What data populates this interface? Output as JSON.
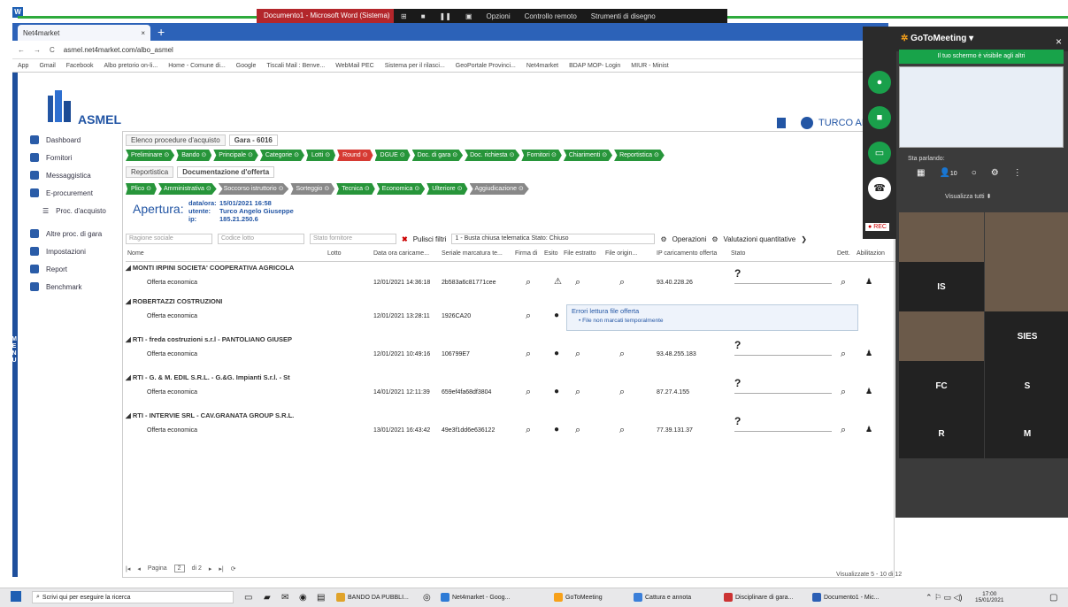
{
  "remote_bar": {
    "title": "Documento1 - Microsoft Word (Sistema)",
    "items": [
      "Opzioni",
      "Controllo remoto",
      "Strumenti di disegno"
    ]
  },
  "browser": {
    "tab_title": "Net4market",
    "url": "asmel.net4market.com/albo_asmel",
    "bookmarks": [
      "App",
      "Gmail",
      "Facebook",
      "Albo pretorio on-li...",
      "Home - Comune di...",
      "Google",
      "Tiscali Mail : Benve...",
      "WebMail PEC",
      "Sistema per il rilasci...",
      "GeoPortale Provinci...",
      "Net4market",
      "BDAP MOP- Login",
      "MIUR - Minist"
    ]
  },
  "app": {
    "logo": "ASMEL",
    "user": "TURCO AN",
    "menu_vertical": "MENU",
    "sidebar": [
      "Dashboard",
      "Fornitori",
      "Messaggistica",
      "E-procurement",
      "Proc. d'acquisto",
      "Altre proc. di gara",
      "Impostazioni",
      "Report",
      "Benchmark"
    ],
    "crumbs1": [
      "Elenco procedure d'acquisto",
      "Gara - 6016"
    ],
    "steps1": [
      {
        "l": "Preliminare",
        "c": "g"
      },
      {
        "l": "Bando",
        "c": "g"
      },
      {
        "l": "Principale",
        "c": "g"
      },
      {
        "l": "Categorie",
        "c": "g"
      },
      {
        "l": "Lotti",
        "c": "g"
      },
      {
        "l": "Round",
        "c": "r"
      },
      {
        "l": "DGUE",
        "c": "g"
      },
      {
        "l": "Doc. di gara",
        "c": "g"
      },
      {
        "l": "Doc. richiesta",
        "c": "g"
      },
      {
        "l": "Fornitori",
        "c": "g"
      },
      {
        "l": "Chiarimenti",
        "c": "g"
      },
      {
        "l": "Reportistica",
        "c": "g"
      }
    ],
    "crumbs2": [
      "Reportistica",
      "Documentazione d'offerta"
    ],
    "steps2": [
      {
        "l": "Plico",
        "c": "g"
      },
      {
        "l": "Amministrativa",
        "c": "g"
      },
      {
        "l": "Soccorso istruttorio",
        "c": "gr"
      },
      {
        "l": "Sorteggio",
        "c": "gr"
      },
      {
        "l": "Tecnica",
        "c": "g"
      },
      {
        "l": "Economica",
        "c": "g"
      },
      {
        "l": "Ulteriore",
        "c": "g"
      },
      {
        "l": "Aggiudicazione",
        "c": "gr"
      }
    ],
    "apertura": "Apertura:",
    "ap_labels": [
      "data/ora:",
      "utente:",
      "ip:"
    ],
    "ap_values": [
      "15/01/2021 16:58",
      "Turco Angelo Giuseppe",
      "185.21.250.6"
    ],
    "filters": {
      "ragione": "Ragione sociale",
      "codice": "Codice lotto",
      "stato": "Stato fornitore",
      "pulisci": "Pulisci filtri",
      "busta": "1 - Busta chiusa telematica  Stato: Chiuso",
      "operazioni": "Operazioni",
      "valutazioni": "Valutazioni quantitative"
    },
    "headers": [
      "Nome",
      "Lotto",
      "Data ora caricame...",
      "Seriale marcatura te...",
      "Firma di",
      "Esito",
      "File estratto",
      "File origin...",
      "IP caricamento offerta",
      "Stato",
      "Dett.",
      "Abilitazion"
    ],
    "groups": [
      {
        "name": "MONTI IRPINI SOCIETA' COOPERATIVA AGRICOLA",
        "sub": "Offerta economica",
        "date": "12/01/2021 14:36:18",
        "serial": "2b583a6c81771cee",
        "ip": "93.40.228.26",
        "esito": "warn"
      },
      {
        "name": "ROBERTAZZI COSTRUZIONI",
        "sub": "Offerta economica",
        "date": "12/01/2021 13:28:11",
        "serial": "1926CA20",
        "ip": "",
        "esito": "ok"
      },
      {
        "name": "RTI - freda costruzioni s.r.l - PANTOLIANO GIUSEP",
        "sub": "Offerta economica",
        "date": "12/01/2021 10:49:16",
        "serial": "106799E7",
        "ip": "93.48.255.183",
        "esito": "ok"
      },
      {
        "name": "RTI - G. & M. EDIL S.R.L. - G.&G. Impianti S.r.l. - St",
        "sub": "Offerta economica",
        "date": "14/01/2021 12:11:39",
        "serial": "659ef4fa68df3804",
        "ip": "87.27.4.155",
        "esito": "ok"
      },
      {
        "name": "RTI - INTERVIE SRL - CAV.GRANATA GROUP S.R.L.",
        "sub": "Offerta economica",
        "date": "13/01/2021 16:43:42",
        "serial": "49e3f1dd6e636122",
        "ip": "77.39.131.37",
        "esito": "ok"
      }
    ],
    "tooltip_title": "Errori lettura file offerta",
    "tooltip_item": "File non marcati temporalmente",
    "pager": {
      "label": "Pagina",
      "page": "2",
      "of": "di 2",
      "summary": "Visualizzate 5 - 10 di 12"
    }
  },
  "gotomeeting": {
    "title": "GoToMeeting",
    "banner": "Il tuo schermo è visibile agli altri",
    "speaking": "Sta parlando:",
    "count": "10",
    "view_all": "Visualizza tutti",
    "rec": "REC",
    "tiles": [
      "",
      "",
      "IS",
      "",
      "",
      "SIES",
      "FC",
      "S",
      "R",
      "M"
    ]
  },
  "taskbar": {
    "search": "Scrivi qui per eseguire la ricerca",
    "items": [
      "BANDO DA PUBBLI...",
      "Net4market - Goog...",
      "GoToMeeting",
      "Cattura e annota",
      "Disciplinare di gara...",
      "Documento1 - Mic..."
    ],
    "time": "17:00",
    "date": "15/01/2021"
  }
}
